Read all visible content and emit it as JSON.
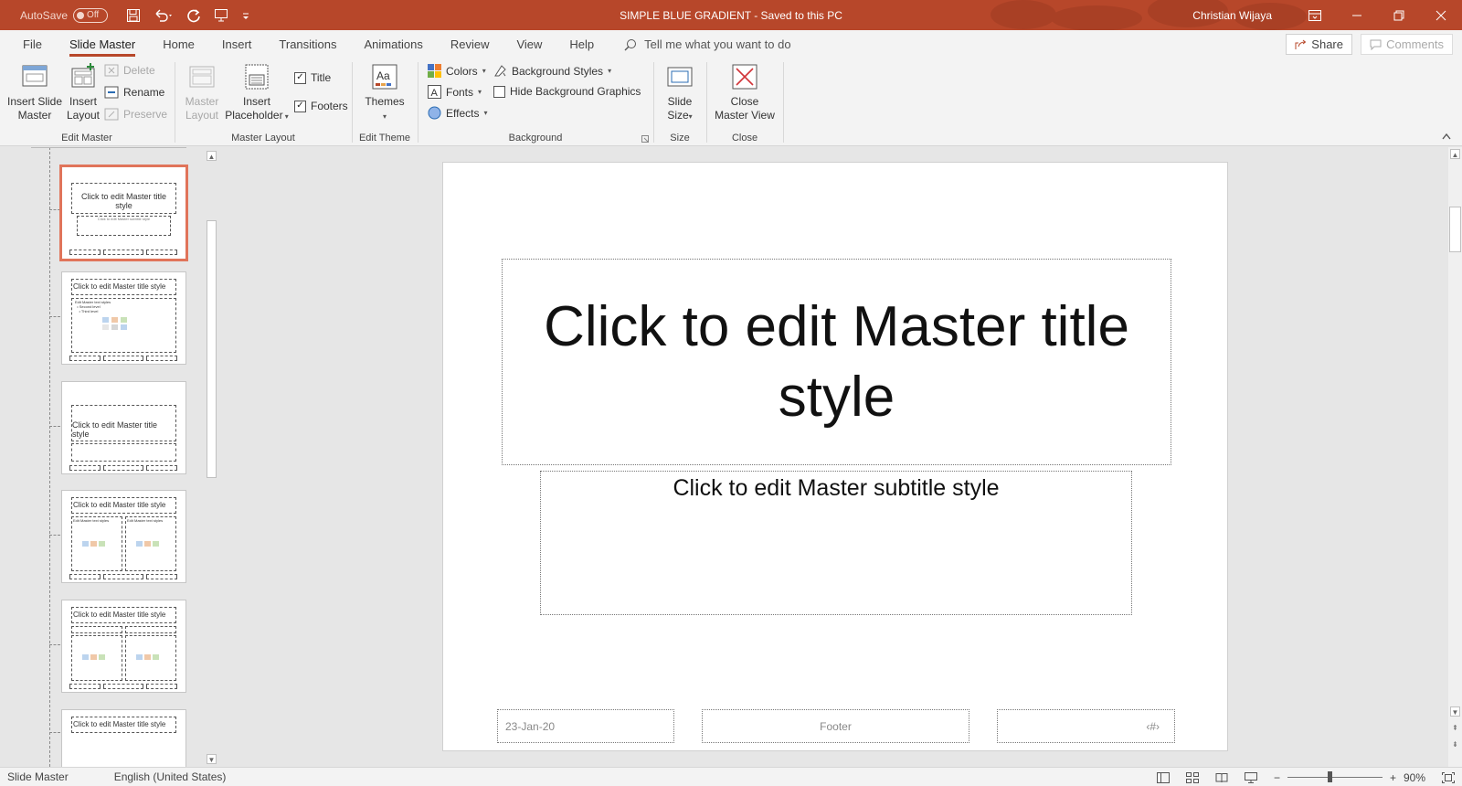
{
  "titlebar": {
    "autosave_label": "AutoSave",
    "autosave_state": "Off",
    "doc_title": "SIMPLE BLUE GRADIENT  -  Saved to this PC",
    "user": "Christian Wijaya",
    "accent": "#b7472a"
  },
  "tabs": {
    "items": [
      "File",
      "Slide Master",
      "Home",
      "Insert",
      "Transitions",
      "Animations",
      "Review",
      "View",
      "Help"
    ],
    "active": "Slide Master",
    "tell_me": "Tell me what you want to do",
    "share": "Share",
    "comments": "Comments"
  },
  "ribbon": {
    "edit_master": {
      "label": "Edit Master",
      "insert_slide_master": "Insert Slide Master",
      "insert_slide_master_l1": "Insert Slide",
      "insert_slide_master_l2": "Master",
      "insert_layout_l1": "Insert",
      "insert_layout_l2": "Layout",
      "delete": "Delete",
      "rename": "Rename",
      "preserve": "Preserve"
    },
    "master_layout": {
      "label": "Master Layout",
      "master_layout_l1": "Master",
      "master_layout_l2": "Layout",
      "insert_placeholder_l1": "Insert",
      "insert_placeholder_l2": "Placeholder",
      "title": "Title",
      "footers": "Footers"
    },
    "edit_theme": {
      "label": "Edit Theme",
      "themes": "Themes"
    },
    "background": {
      "label": "Background",
      "colors": "Colors",
      "fonts": "Fonts",
      "effects": "Effects",
      "background_styles": "Background Styles",
      "hide_background_graphics": "Hide Background Graphics"
    },
    "size": {
      "label": "Size",
      "slide_size_l1": "Slide",
      "slide_size_l2": "Size"
    },
    "close": {
      "label": "Close",
      "close_master_view_l1": "Close",
      "close_master_view_l2": "Master View"
    }
  },
  "thumbnails": {
    "title_text": "Click to edit Master title style",
    "title_text_l1": "Click to edit Master title",
    "title_text_l2": "style",
    "section_l1": "Click to edit Master title",
    "section_l2": "style",
    "subtitle_text": "Click to edit Master subtitle style",
    "text_styles": "Edit Master text styles",
    "second_level": "Second level",
    "third_level": "Third level"
  },
  "slide": {
    "title": "Click to edit Master title style",
    "title_l1": "Click to edit Master title",
    "title_l2": "style",
    "subtitle": "Click to edit Master subtitle style",
    "date": "23-Jan-20",
    "footer": "Footer",
    "number": "‹#›"
  },
  "status": {
    "view": "Slide Master",
    "language": "English (United States)",
    "zoom": "90%",
    "zoom_level": 0.9
  }
}
